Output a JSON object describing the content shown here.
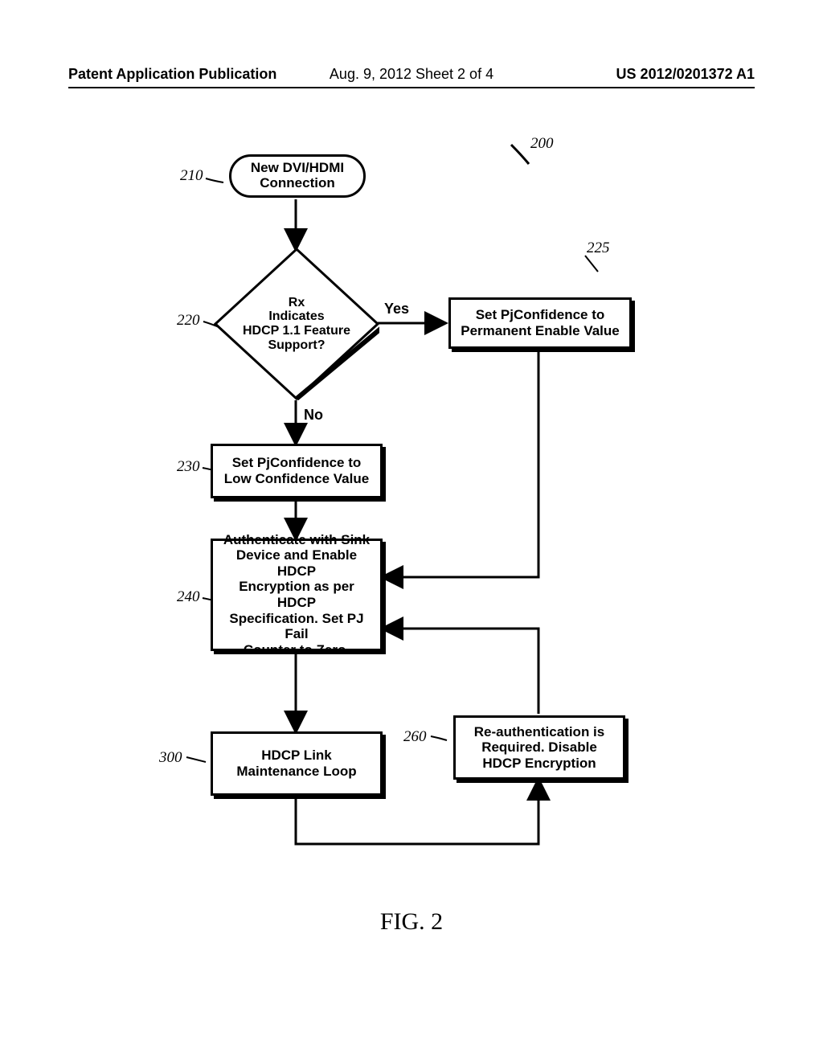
{
  "header": {
    "left": "Patent Application Publication",
    "mid": "Aug. 9, 2012  Sheet 2 of 4",
    "right": "US 2012/0201372 A1"
  },
  "figure": {
    "caption": "FIG. 2",
    "ref_200": "200",
    "labels": {
      "n210": "210",
      "n220": "220",
      "n225": "225",
      "n230": "230",
      "n240": "240",
      "n260": "260",
      "n300": "300"
    },
    "nodes": {
      "start": "New DVI/HDMI\nConnection",
      "decision": "Rx\nIndicates\nHDCP 1.1 Feature\nSupport?",
      "yes": "Yes",
      "no": "No",
      "box225": "Set PjConfidence to\nPermanent Enable Value",
      "box230": "Set PjConfidence to\nLow Confidence Value",
      "box240": "Authenticate with Sink\nDevice and Enable HDCP\nEncryption as per HDCP\nSpecification. Set PJ Fail\nCounter to Zero.",
      "box260": "Re-authentication is\nRequired. Disable\nHDCP Encryption",
      "box300": "HDCP Link\nMaintenance Loop"
    }
  }
}
